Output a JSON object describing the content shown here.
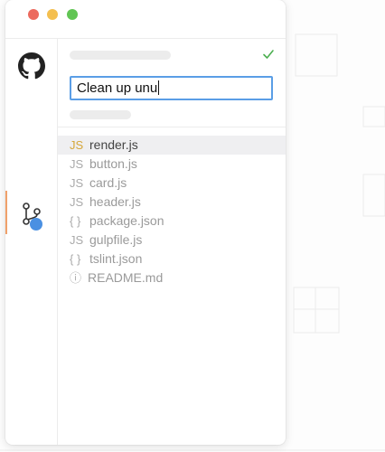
{
  "window": {
    "traffic_lights": {
      "close_color": "#ec6a5e",
      "minimize_color": "#f4bf4f",
      "maximize_color": "#61c554"
    }
  },
  "sidebar": {
    "items": [
      {
        "icon": "github-icon",
        "active": false
      },
      {
        "icon": "source-control-icon",
        "active": true,
        "badge_color": "#4a90e2"
      }
    ],
    "accent_color": "#f0a16b"
  },
  "commit": {
    "status_icon": "check-icon",
    "status_color": "#4caf50",
    "message_value": "Clean up unu",
    "focus_color": "#5a9ee6"
  },
  "files": [
    {
      "icon_text": "JS",
      "name": "render.js",
      "selected": true
    },
    {
      "icon_text": "JS",
      "name": "button.js",
      "selected": false
    },
    {
      "icon_text": "JS",
      "name": "card.js",
      "selected": false
    },
    {
      "icon_text": "JS",
      "name": "header.js",
      "selected": false
    },
    {
      "icon_text": "{ }",
      "name": "package.json",
      "selected": false
    },
    {
      "icon_text": "JS",
      "name": "gulpfile.js",
      "selected": false
    },
    {
      "icon_text": "{ }",
      "name": "tslint.json",
      "selected": false
    },
    {
      "icon_text": "ⓘ",
      "name": "README.md",
      "selected": false
    }
  ]
}
